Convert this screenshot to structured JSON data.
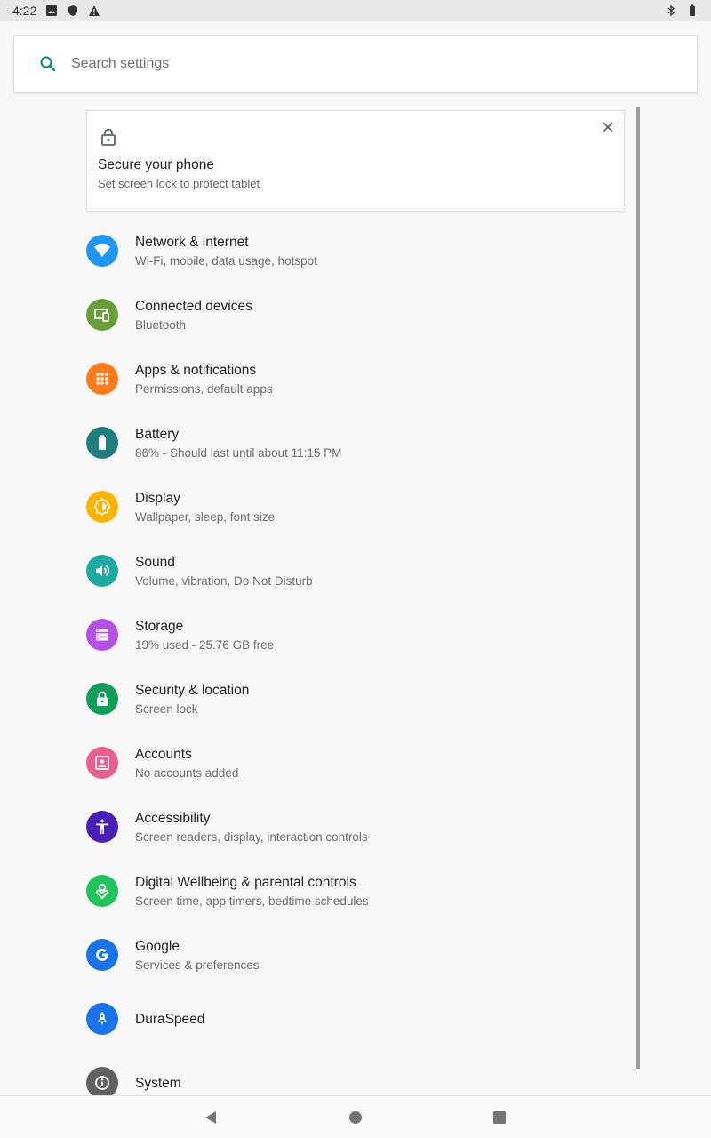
{
  "status_bar": {
    "time": "4:22",
    "icons_left": [
      "image-icon",
      "shield-icon",
      "warning-icon"
    ],
    "icons_right": [
      "bluetooth-icon",
      "battery-icon"
    ]
  },
  "search": {
    "placeholder": "Search settings"
  },
  "suggestion": {
    "title": "Secure your phone",
    "summary": "Set screen lock to protect tablet"
  },
  "items": [
    {
      "title": "Network & internet",
      "summary": "Wi‑Fi, mobile, data usage, hotspot",
      "icon": "wifi-icon",
      "color": "#2196f3"
    },
    {
      "title": "Connected devices",
      "summary": "Bluetooth",
      "icon": "devices-icon",
      "color": "#689f38"
    },
    {
      "title": "Apps & notifications",
      "summary": "Permissions, default apps",
      "icon": "apps-icon",
      "color": "#ff7a1a"
    },
    {
      "title": "Battery",
      "summary": "86% - Should last until about 11:15 PM",
      "icon": "battery-icon",
      "color": "#1f7f7f"
    },
    {
      "title": "Display",
      "summary": "Wallpaper, sleep, font size",
      "icon": "brightness-icon",
      "color": "#ffb300"
    },
    {
      "title": "Sound",
      "summary": "Volume, vibration, Do Not Disturb",
      "icon": "volume-icon",
      "color": "#1ea9a3"
    },
    {
      "title": "Storage",
      "summary": "19% used - 25.76 GB free",
      "icon": "storage-icon",
      "color": "#b64fe6"
    },
    {
      "title": "Security & location",
      "summary": "Screen lock",
      "icon": "lock-icon",
      "color": "#0f9d58"
    },
    {
      "title": "Accounts",
      "summary": "No accounts added",
      "icon": "account-icon",
      "color": "#e95f8f"
    },
    {
      "title": "Accessibility",
      "summary": "Screen readers, display, interaction controls",
      "icon": "accessibility-icon",
      "color": "#4a1fb8"
    },
    {
      "title": "Digital Wellbeing & parental controls",
      "summary": "Screen time, app timers, bedtime schedules",
      "icon": "wellbeing-icon",
      "color": "#1fc45a"
    },
    {
      "title": "Google",
      "summary": "Services & preferences",
      "icon": "google-icon",
      "color": "#1a73e8"
    },
    {
      "title": "DuraSpeed",
      "summary": "",
      "icon": "rocket-icon",
      "color": "#1a73e8"
    },
    {
      "title": "System",
      "summary": "",
      "icon": "info-icon",
      "color": "#616161"
    }
  ],
  "nav": {
    "back": "back-icon",
    "home": "home-icon",
    "recents": "recents-icon"
  }
}
